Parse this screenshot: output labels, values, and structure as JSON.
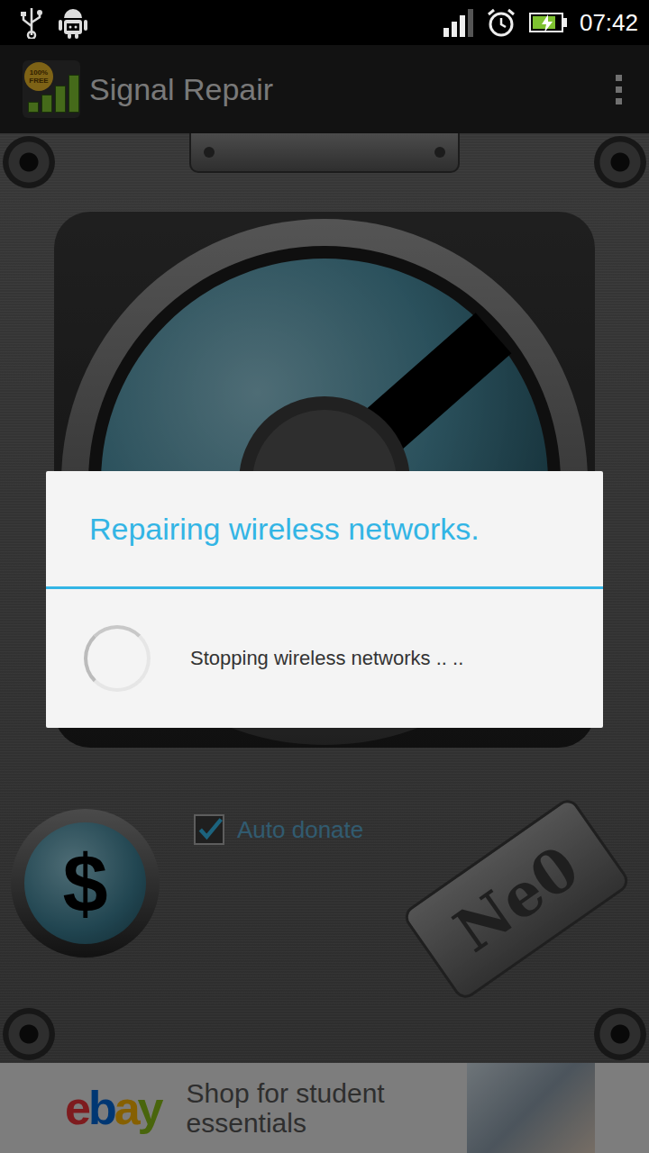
{
  "status_bar": {
    "time": "07:42",
    "signal_level": 0.75,
    "battery_level": 0.85,
    "battery_charging": true
  },
  "action_bar": {
    "title": "Signal Repair",
    "logo_badge": [
      "100%",
      "FREE"
    ]
  },
  "gauge": {
    "level": 0.68
  },
  "dialog": {
    "title": "Repairing wireless networks.",
    "message": "Stopping wireless networks .. .."
  },
  "donate_button": {
    "label": "$"
  },
  "auto_donate": {
    "label": "Auto donate",
    "checked": true
  },
  "nameplate": {
    "label": "Ne0"
  },
  "ad": {
    "logo": [
      {
        "char": "e",
        "color": "#e53238"
      },
      {
        "char": "b",
        "color": "#0064d2"
      },
      {
        "char": "a",
        "color": "#f5af02"
      },
      {
        "char": "y",
        "color": "#86b817"
      }
    ],
    "text": "Shop for student essentials"
  }
}
